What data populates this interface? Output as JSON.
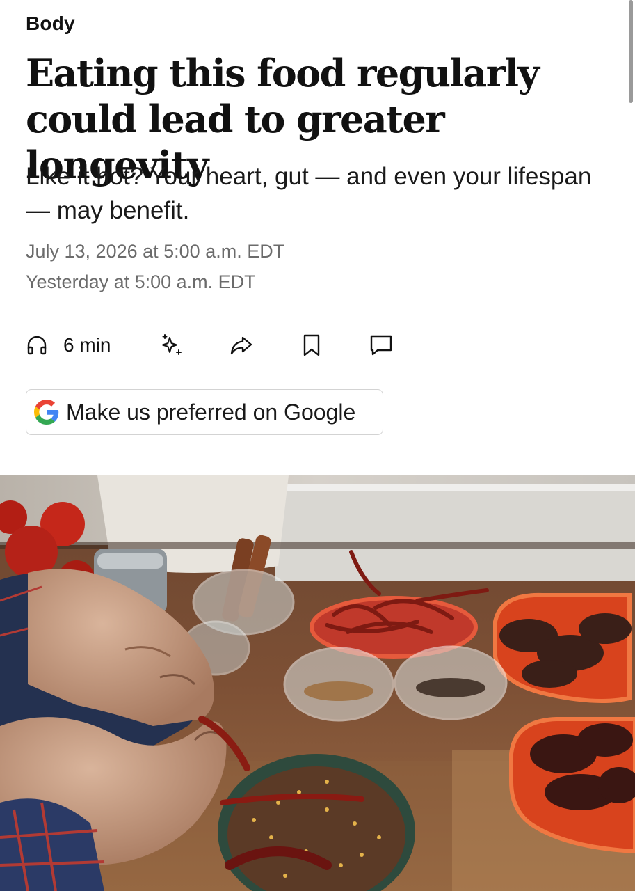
{
  "article": {
    "section": "Body",
    "headline": "Eating this food regularly could lead to greater longevity",
    "dek": "Like it hot? Your heart, gut — and even your lifespan — may benefit.",
    "published": "July 13, 2026 at 5:00 a.m. EDT",
    "updated": "Yesterday at 5:00 a.m. EDT"
  },
  "actions": {
    "listen_label": "6 min",
    "icons": [
      "headphones-icon",
      "sparkle-icon",
      "share-icon",
      "bookmark-icon",
      "comment-icon"
    ]
  },
  "google_button": {
    "label": "Make us preferred on Google",
    "icon": "google-g-icon",
    "colors": [
      "#4285F4",
      "#EA4335",
      "#FBBC05",
      "#34A853"
    ]
  },
  "colors": {
    "text": "#111111",
    "meta": "#6b6b6b",
    "border": "#d3d3d3"
  }
}
